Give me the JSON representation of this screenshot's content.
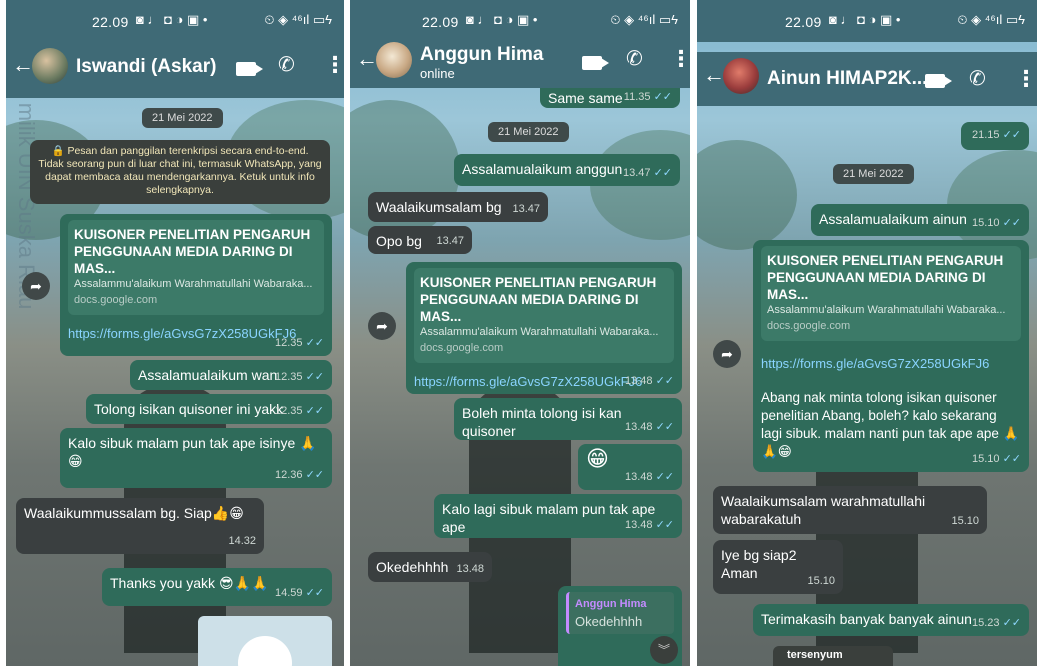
{
  "screens": [
    {
      "status_time": "22.09",
      "status_icons": "◙ ♩ ◘ ◑ ▣ •",
      "status_icons_right": "⏲ ◈ ⁴⁶ıl ▭ϟ",
      "contact_name": "Iswandi (Askar)",
      "date_label": "21 Mei 2022",
      "encryption_notice": "🔒 Pesan dan panggilan terenkripsi secara end-to-end. Tidak seorang pun di luar chat ini, termasuk WhatsApp, yang dapat membaca atau mendengarkannya. Ketuk untuk info selengkapnya.",
      "card": {
        "title": "KUISONER PENELITIAN PENGARUH PENGGUNAAN MEDIA DARING DI MAS...",
        "desc": "Assalammu'alaikum Warahmatullahi Wabaraka...",
        "host": "docs.google.com",
        "link": "https://forms.gle/aGvsG7zX258UGkFJ6",
        "time": "12.35"
      },
      "messages": [
        {
          "text": "Assalamualaikum wan",
          "time": "12.35"
        },
        {
          "text": "Tolong isikan quisoner ini yakk",
          "time": "12.35"
        },
        {
          "text": "Kalo sibuk malam pun tak ape isinye 🙏 😁",
          "time": "12.36"
        },
        {
          "text": "Waalaikummussalam bg.  Siap👍😁",
          "time": "14.32"
        },
        {
          "text": "Thanks you yakk 😎🙏🙏",
          "time": "14.59"
        }
      ],
      "watermark": "Hak Cipta milik UIN Suska Riau"
    },
    {
      "status_time": "22.09",
      "status_icons": "◙ ♩ ◘ ◑ ▣ •",
      "status_icons_right": "⏲ ◈ ⁴⁶ıl ▭ϟ",
      "contact_name": "Anggun Hima",
      "contact_status": "online",
      "top_partial": {
        "text": "Same same",
        "time": "11.35"
      },
      "date_label": "21 Mei 2022",
      "messages": [
        {
          "text": "Assalamualaikum anggun",
          "time": "13.47"
        },
        {
          "text": "Waalaikumsalam bg",
          "time": "13.47"
        },
        {
          "text": "Opo bg",
          "time": "13.47"
        },
        {
          "text": "Boleh minta tolong isi kan quisoner",
          "time": "13.48"
        },
        {
          "text": "😁",
          "time": "13.48"
        },
        {
          "text": "Kalo lagi sibuk malam pun tak ape ape",
          "time": "13.48"
        },
        {
          "text": "Okedehhhh",
          "time": "13.48"
        }
      ],
      "card": {
        "title": "KUISONER PENELITIAN PENGARUH PENGGUNAAN MEDIA DARING DI MAS...",
        "desc": "Assalammu'alaikum Warahmatullahi Wabaraka...",
        "host": "docs.google.com",
        "link": "https://forms.gle/aGvsG7zX258UGkFJ6",
        "time": "13.48"
      },
      "reply": {
        "author": "Anggun Hima",
        "text": "Okedehhhh"
      },
      "scroll_icon": "︾"
    },
    {
      "status_time": "22.09",
      "status_icons": "◙ ♩ ◘ ◑ ▣ •",
      "status_icons_right": "⏲ ◈ ⁴⁶ıl ▭ϟ",
      "contact_name": "Ainun HIMAP2K...",
      "top_time": "21.15",
      "date_label": "21 Mei 2022",
      "messages": [
        {
          "text": "Assalamualaikum ainun",
          "time": "15.10"
        },
        {
          "text": "Abang nak minta tolong isikan quisoner penelitian Abang, boleh? kalo sekarang lagi sibuk. malam nanti pun tak ape ape 🙏🙏😁",
          "time": "15.10"
        },
        {
          "text": "Waalaikumsalam warahmatullahi wabarakatuh",
          "time": "15.10"
        },
        {
          "text": "Iye bg siap2 Aman",
          "time": "15.10"
        },
        {
          "text": "Terimakasih banyak banyak ainun",
          "time": "15.23"
        }
      ],
      "card": {
        "title": "KUISONER PENELITIAN PENGARUH PENGGUNAAN MEDIA DARING DI MAS...",
        "desc": "Assalammu'alaikum Warahmatullahi Wabaraka...",
        "host": "docs.google.com",
        "link": "https://forms.gle/aGvsG7zX258UGkFJ6"
      },
      "bottom_partial": "tersenyum"
    }
  ],
  "icons": {
    "back": "back-arrow-icon",
    "video": "video-call-icon",
    "phone": "phone-icon",
    "menu": "more-vert-icon",
    "forward": "forward-icon",
    "ticks": "✓✓"
  },
  "colors": {
    "header": "#3f6a76",
    "outgoing": "#2f6b5a",
    "incoming": "#3a3f40",
    "link": "#8ad4ff"
  }
}
